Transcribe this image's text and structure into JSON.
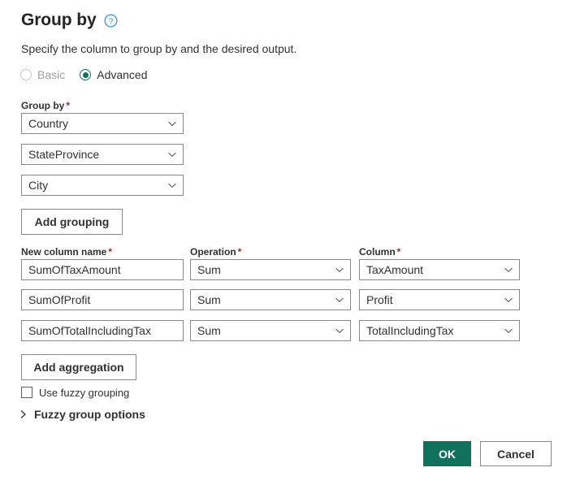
{
  "dialog": {
    "title": "Group by",
    "subtitle": "Specify the column to group by and the desired output.",
    "help_icon": "help-circle-icon"
  },
  "mode": {
    "options": [
      {
        "label": "Basic",
        "selected": false,
        "disabled": true
      },
      {
        "label": "Advanced",
        "selected": true,
        "disabled": false
      }
    ]
  },
  "group_by": {
    "label": "Group by",
    "required_marker": "*",
    "rows": [
      {
        "value": "Country"
      },
      {
        "value": "StateProvince"
      },
      {
        "value": "City"
      }
    ],
    "add_button": "Add grouping"
  },
  "aggregations": {
    "headers": {
      "new_column_name": "New column name",
      "operation": "Operation",
      "column": "Column",
      "required_marker": "*"
    },
    "rows": [
      {
        "name": "SumOfTaxAmount",
        "operation": "Sum",
        "column": "TaxAmount"
      },
      {
        "name": "SumOfProfit",
        "operation": "Sum",
        "column": "Profit"
      },
      {
        "name": "SumOfTotalIncludingTax",
        "operation": "Sum",
        "column": "TotalIncludingTax"
      }
    ],
    "add_button": "Add aggregation"
  },
  "fuzzy": {
    "checkbox_label": "Use fuzzy grouping",
    "checked": false,
    "expander_label": "Fuzzy group options",
    "expanded": false
  },
  "footer": {
    "ok_label": "OK",
    "cancel_label": "Cancel"
  },
  "colors": {
    "accent": "#11715c",
    "required": "#a4262c",
    "help_icon": "#0078d4",
    "border": "#8a8886",
    "text": "#323130",
    "disabled_text": "#a19f9d"
  }
}
